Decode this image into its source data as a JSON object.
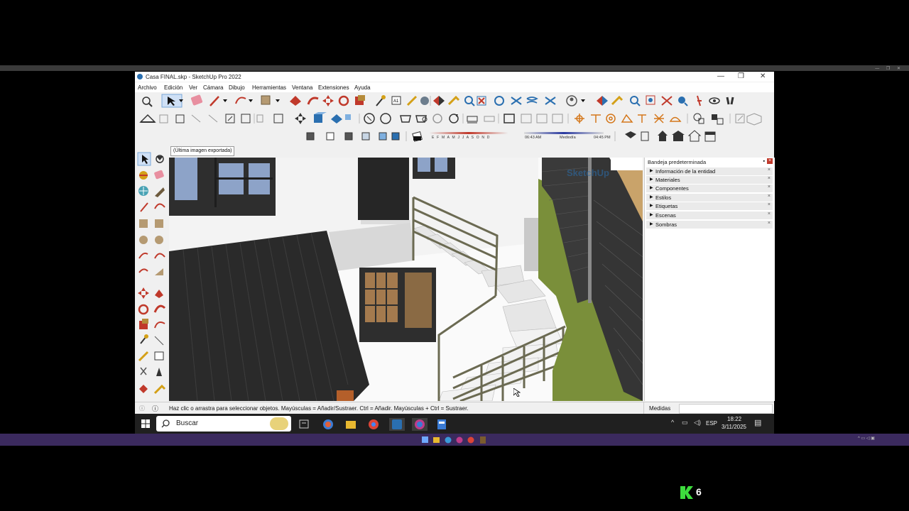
{
  "window": {
    "title": "Casa FINAL.skp - SketchUp Pro 2022",
    "controls": [
      "—",
      "❐",
      "✕"
    ]
  },
  "menu": [
    "Archivo",
    "Edición",
    "Ver",
    "Cámara",
    "Dibujo",
    "Herramientas",
    "Ventana",
    "Extensiones",
    "Ayuda"
  ],
  "shadow_bar": {
    "months": "E F M A M J J A S O N D",
    "time_start": "06:43 AM",
    "time_mid": "Mediodía",
    "time_end": "04:45 PM"
  },
  "tooltip": "(Última imagen exportada)",
  "watermark": "SketchUp",
  "tray": {
    "title": "Bandeja predeterminada",
    "items": [
      "Información de la entidad",
      "Materiales",
      "Componentes",
      "Estilos",
      "Etiquetas",
      "Escenas",
      "Sombras"
    ]
  },
  "status": {
    "hint": "Haz clic o arrastra para seleccionar objetos. Mayúsculas = Añadir/Sustraer. Ctrl = Añadir. Mayúsculas + Ctrl = Sustraer.",
    "measure_label": "Medidas"
  },
  "taskbar": {
    "search": "Buscar",
    "lang": "ESP",
    "time": "18:22",
    "date": "3/11/2025"
  },
  "badge": "6",
  "colors": {
    "accent_red": "#c0392b",
    "sketchup_blue": "#2a6fb0",
    "taskbar": "#202020",
    "grass": "#7a8f3a"
  }
}
